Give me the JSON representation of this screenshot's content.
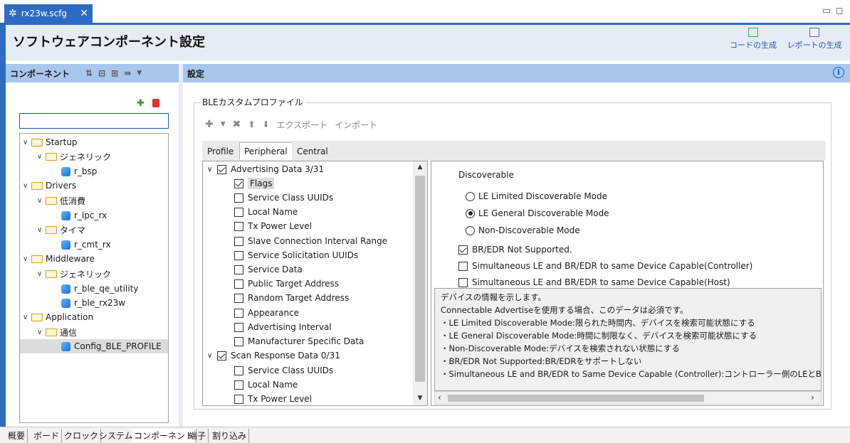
{
  "editor_tab": {
    "label": "rx23w.scfg"
  },
  "header": {
    "title": "ソフトウェアコンポーネント設定",
    "generate_code": "コードの生成",
    "generate_report": "レポートの生成"
  },
  "left_pane": {
    "title": "コンポーネント",
    "search": {
      "value": "",
      "placeholder": ""
    },
    "tree": [
      {
        "label": "Startup"
      },
      {
        "label": "ジェネリック"
      },
      {
        "label": "r_bsp"
      },
      {
        "label": "Drivers"
      },
      {
        "label": "低消費"
      },
      {
        "label": "r_lpc_rx"
      },
      {
        "label": "タイマ"
      },
      {
        "label": "r_cmt_rx"
      },
      {
        "label": "Middleware"
      },
      {
        "label": "ジェネリック"
      },
      {
        "label": "r_ble_qe_utility"
      },
      {
        "label": "r_ble_rx23w"
      },
      {
        "label": "Application"
      },
      {
        "label": "通信"
      },
      {
        "label": "Config_BLE_PROFILE"
      }
    ]
  },
  "right_pane": {
    "title": "設定",
    "group_title": "BLEカスタムプロファイル",
    "actions": {
      "export": "エクスポート",
      "import": "インポート"
    },
    "tabs": [
      "Profile",
      "Peripheral",
      "Central"
    ],
    "list": [
      {
        "label": "Advertising Data 3/31",
        "checked": true
      },
      {
        "label": "Flags",
        "checked": true
      },
      {
        "label": "Service Class UUIDs",
        "checked": false
      },
      {
        "label": "Local Name",
        "checked": false
      },
      {
        "label": "Tx Power Level",
        "checked": false
      },
      {
        "label": "Slave Connection Interval Range",
        "checked": false
      },
      {
        "label": "Service Solicitation UUIDs",
        "checked": false
      },
      {
        "label": "Service Data",
        "checked": false
      },
      {
        "label": "Public Target Address",
        "checked": false
      },
      {
        "label": "Random Target Address",
        "checked": false
      },
      {
        "label": "Appearance",
        "checked": false
      },
      {
        "label": "Advertising Interval",
        "checked": false
      },
      {
        "label": "Manufacturer Specific Data",
        "checked": false
      },
      {
        "label": "Scan Response Data 0/31",
        "checked": true
      },
      {
        "label": "Service Class UUIDs",
        "checked": false
      },
      {
        "label": "Local Name",
        "checked": false
      },
      {
        "label": "Tx Power Level",
        "checked": false
      }
    ],
    "detail": {
      "heading": "Discoverable",
      "radios": [
        {
          "label": "LE Limited Discoverable Mode",
          "selected": false
        },
        {
          "label": "LE General Discoverable Mode",
          "selected": true
        },
        {
          "label": "Non-Discoverable Mode",
          "selected": false
        }
      ],
      "checks": [
        {
          "label": "BR/EDR Not Supported.",
          "checked": true
        },
        {
          "label": "Simultaneous LE and BR/EDR to same Device Capable(Controller)",
          "checked": false
        },
        {
          "label": "Simultaneous LE and BR/EDR to same Device Capable(Host)",
          "checked": false
        }
      ],
      "description": [
        "デバイスの情報を示します。",
        "Connectable Advertiseを使用する場合、このデータは必須です。",
        "・LE Limited Discoverable Mode:限られた時間内、デバイスを検索可能状態にする",
        "・LE General Discoverable Mode:時間に制限なく、デバイスを検索可能状態にする",
        "・Non-Discoverable Mode:デバイスを検索されない状態にする",
        "・BR/EDR Not Supported:BR/EDRをサポートしない",
        "・Simultaneous LE and BR/EDR to Same Device Capable (Controller):コントローラー側のLEとBR/E"
      ]
    }
  },
  "bottom_tabs": [
    "概要",
    "ボード",
    "クロック",
    "システム",
    "コンポーネント",
    "端子",
    "割り込み"
  ],
  "colors": {
    "accent": "#2d6bc1",
    "pane_header": "#a9c7ec",
    "header_bg": "#e6ecf5"
  }
}
